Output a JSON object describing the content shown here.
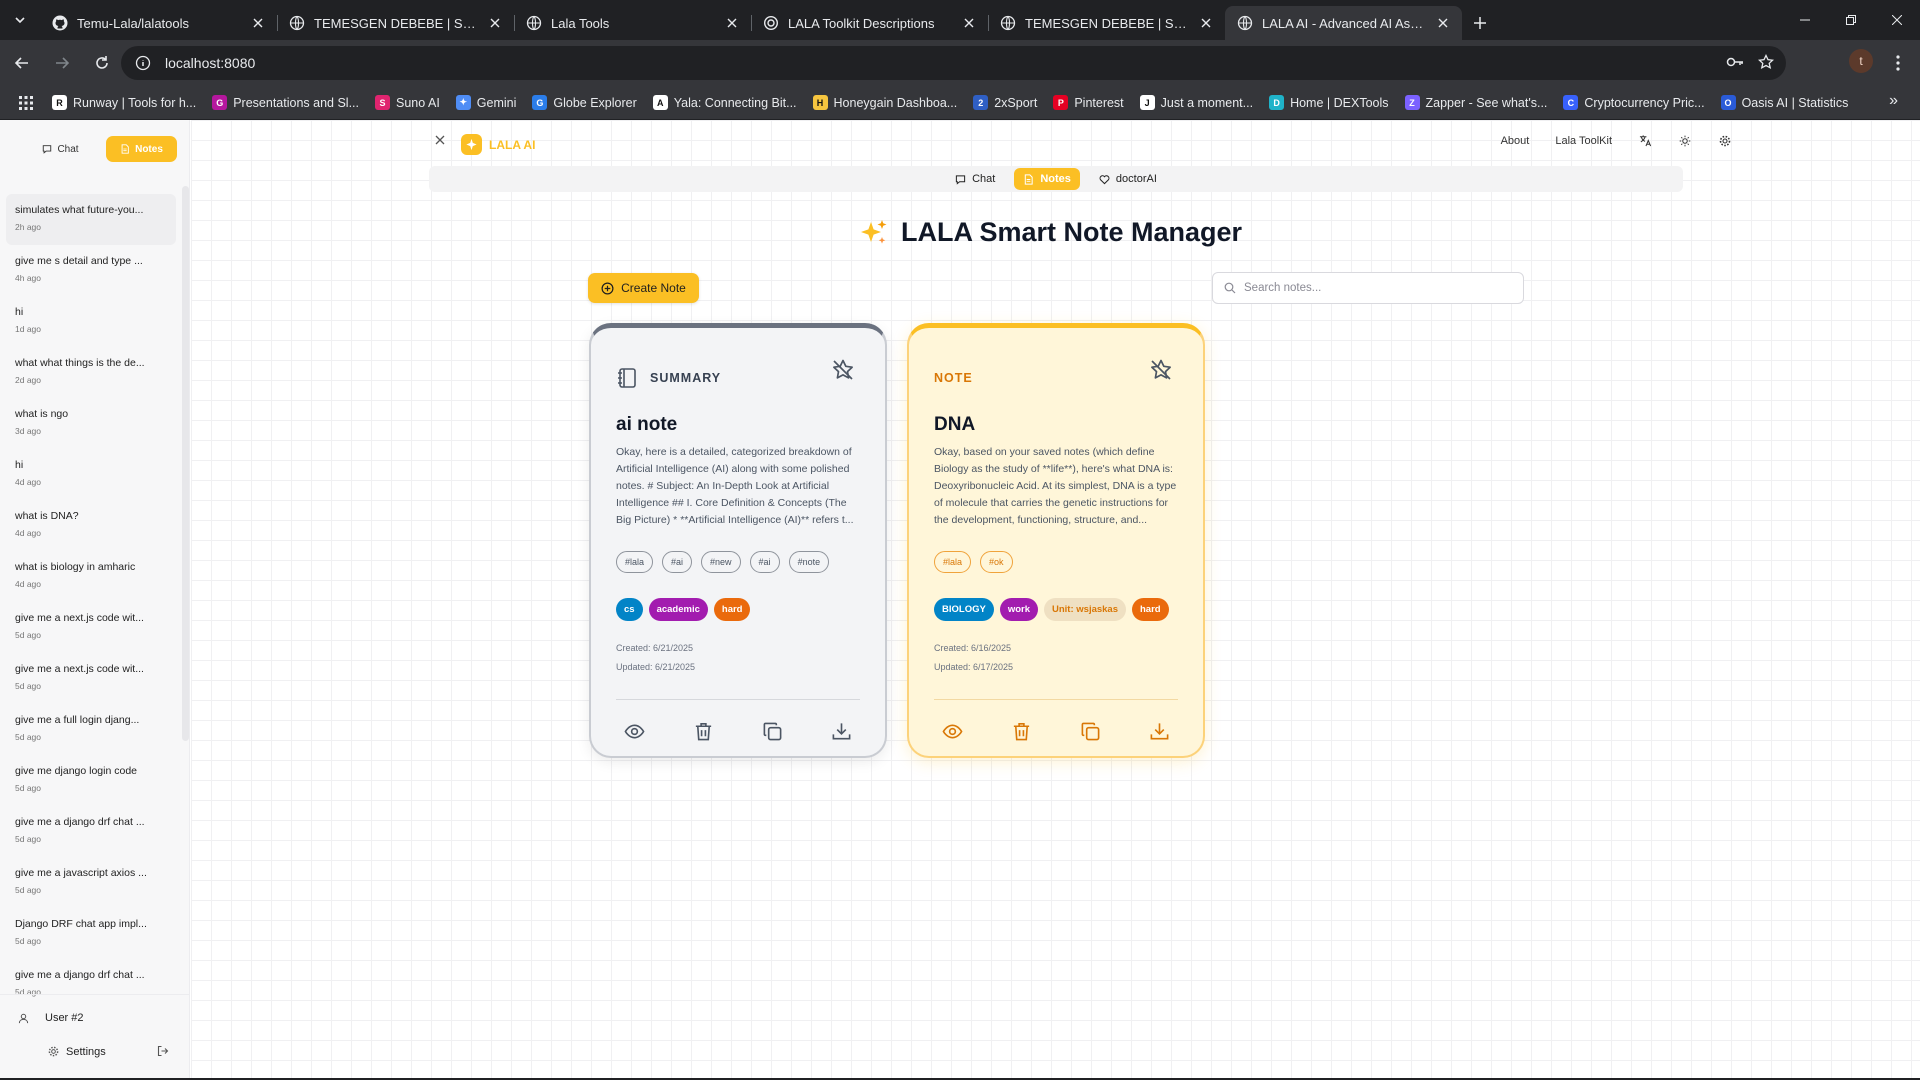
{
  "browser": {
    "tabs": [
      {
        "title": "Temu-Lala/lalatools",
        "icon": "github-icon",
        "active": false
      },
      {
        "title": "TEMESGEN DEBEBE | Software E",
        "icon": "globe-icon",
        "active": false
      },
      {
        "title": "Lala Tools",
        "icon": "globe-icon",
        "active": false
      },
      {
        "title": "LALA Toolkit Descriptions",
        "icon": "openai-icon",
        "active": false
      },
      {
        "title": "TEMESGEN DEBEBE | Software E",
        "icon": "globe-icon",
        "active": false
      },
      {
        "title": "LALA AI - Advanced AI Assistan",
        "icon": "globe-icon",
        "active": true
      }
    ],
    "address": "localhost:8080",
    "profile_initial": "t",
    "bookmarks": [
      {
        "label": "Runway | Tools for h...",
        "color": "#ffffff",
        "glyph": "R",
        "text": "#111111"
      },
      {
        "label": "Presentations and Sl...",
        "color": "#b5179e",
        "glyph": "G",
        "text": "#ffffff"
      },
      {
        "label": "Suno AI",
        "color": "#e0246f",
        "glyph": "S",
        "text": "#ffffff"
      },
      {
        "label": "Gemini",
        "color": "#4f8df5",
        "glyph": "✦",
        "text": "#ffffff"
      },
      {
        "label": "Globe Explorer",
        "color": "#2b7de9",
        "glyph": "G",
        "text": "#ffffff"
      },
      {
        "label": "Yala: Connecting Bit...",
        "color": "#ffffff",
        "glyph": "A",
        "text": "#111111"
      },
      {
        "label": "Honeygain Dashboa...",
        "color": "#f6c53f",
        "glyph": "H",
        "text": "#111111"
      },
      {
        "label": "2xSport",
        "color": "#2f5fc4",
        "glyph": "2",
        "text": "#ffffff"
      },
      {
        "label": "Pinterest",
        "color": "#e60023",
        "glyph": "P",
        "text": "#ffffff"
      },
      {
        "label": "Just a moment...",
        "color": "#ffffff",
        "glyph": "J",
        "text": "#111111"
      },
      {
        "label": "Home | DEXTools",
        "color": "#1fb3c9",
        "glyph": "D",
        "text": "#ffffff"
      },
      {
        "label": "Zapper - See what's...",
        "color": "#7b61ff",
        "glyph": "Z",
        "text": "#ffffff"
      },
      {
        "label": "Cryptocurrency Pric...",
        "color": "#3861fb",
        "glyph": "C",
        "text": "#ffffff"
      },
      {
        "label": "Oasis AI | Statistics",
        "color": "#2a5bd7",
        "glyph": "O",
        "text": "#ffffff"
      }
    ]
  },
  "sidebar": {
    "mode_chat": "Chat",
    "mode_notes": "Notes",
    "history": [
      {
        "title": "simulates what future-you...",
        "time": "2h ago"
      },
      {
        "title": "give me s detail and type ...",
        "time": "4h ago"
      },
      {
        "title": "hi",
        "time": "1d ago"
      },
      {
        "title": "what what things is the de...",
        "time": "2d ago"
      },
      {
        "title": "what is ngo",
        "time": "3d ago"
      },
      {
        "title": "hi",
        "time": "4d ago"
      },
      {
        "title": "what is DNA?",
        "time": "4d ago"
      },
      {
        "title": "what is biology in amharic",
        "time": "4d ago"
      },
      {
        "title": "give me a next.js code wit...",
        "time": "5d ago"
      },
      {
        "title": "give me a next.js code wit...",
        "time": "5d ago"
      },
      {
        "title": "give me a full login djang...",
        "time": "5d ago"
      },
      {
        "title": "give me django login code",
        "time": "5d ago"
      },
      {
        "title": "give me a django drf chat ...",
        "time": "5d ago"
      },
      {
        "title": "give me a javascript axios ...",
        "time": "5d ago"
      },
      {
        "title": "Django DRF chat app impl...",
        "time": "5d ago"
      },
      {
        "title": "give me a django drf chat ...",
        "time": "5d ago"
      }
    ],
    "user": "User #2",
    "settings": "Settings"
  },
  "header": {
    "brand": "LALA AI",
    "about": "About",
    "toolkit": "Lala ToolKit"
  },
  "subnav": {
    "chat": "Chat",
    "notes": "Notes",
    "doctor": "doctorAI"
  },
  "page": {
    "title": "LALA Smart Note Manager",
    "create_label": "Create Note",
    "search_placeholder": "Search notes..."
  },
  "notes": [
    {
      "type": "SUMMARY",
      "title": "ai note",
      "body": "Okay, here is a detailed, categorized breakdown of Artificial Intelligence (AI) along with some polished notes. # Subject: An In-Depth Look at Artificial Intelligence ## I. Core Definition & Concepts (The Big Picture) * **Artificial Intelligence (AI)** refers t...",
      "hashtags": [
        "#lala",
        "#ai",
        "#new",
        "#ai",
        "#note"
      ],
      "chips": [
        {
          "label": "cs",
          "bg": "#0284c7",
          "fg": "#ffffff"
        },
        {
          "label": "academic",
          "bg": "#a21caf",
          "fg": "#ffffff"
        },
        {
          "label": "hard",
          "bg": "#ea6a0c",
          "fg": "#ffffff"
        }
      ],
      "created": "Created: 6/21/2025",
      "updated": "Updated: 6/21/2025"
    },
    {
      "type": "NOTE",
      "title": "DNA",
      "body": "Okay, based on your saved notes (which define Biology as the study of **life**), here's what DNA is: Deoxyribonucleic Acid. At its simplest, DNA is a type of molecule that carries the genetic instructions for the development, functioning, structure, and...",
      "hashtags": [
        "#lala",
        "#ok"
      ],
      "chips": [
        {
          "label": "BIOLOGY",
          "bg": "#0284c7",
          "fg": "#ffffff"
        },
        {
          "label": "work",
          "bg": "#a21caf",
          "fg": "#ffffff"
        },
        {
          "label": "Unit: wsjaskas",
          "bg": "#efe0c2",
          "fg": "#d97706"
        },
        {
          "label": "hard",
          "bg": "#ea6a0c",
          "fg": "#ffffff"
        }
      ],
      "created": "Created: 6/16/2025",
      "updated": "Updated: 6/17/2025"
    }
  ],
  "colors": {
    "accent": "#fbbf24",
    "summary_icon": "#4b5563",
    "note_icon": "#d97706"
  }
}
